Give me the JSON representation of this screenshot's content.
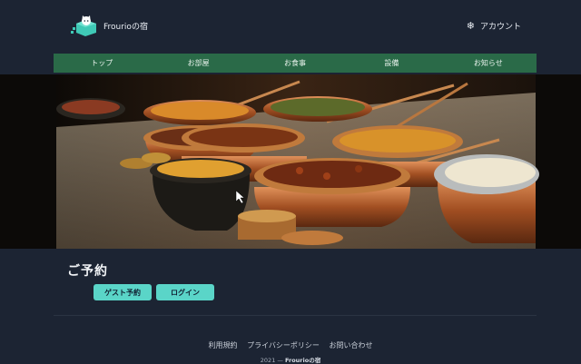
{
  "header": {
    "brand_name": "Frourioの宿",
    "account_label": "アカウント"
  },
  "nav": {
    "items": [
      "トップ",
      "お部屋",
      "お食事",
      "設備",
      "お知らせ"
    ]
  },
  "hero": {
    "alt_subject": "copper serving pots with curries"
  },
  "reserve": {
    "title": "ご予約",
    "guest_button": "ゲスト予約",
    "login_button": "ログイン"
  },
  "footer": {
    "links": [
      "利用規約",
      "プライバシーポリシー",
      "お問い合わせ"
    ],
    "copyright_prefix": "2021 — ",
    "copyright_brand": "Frourioの宿"
  },
  "colors": {
    "background": "#1c2433",
    "nav": "#2a6a48",
    "button": "#5ad5c8"
  }
}
